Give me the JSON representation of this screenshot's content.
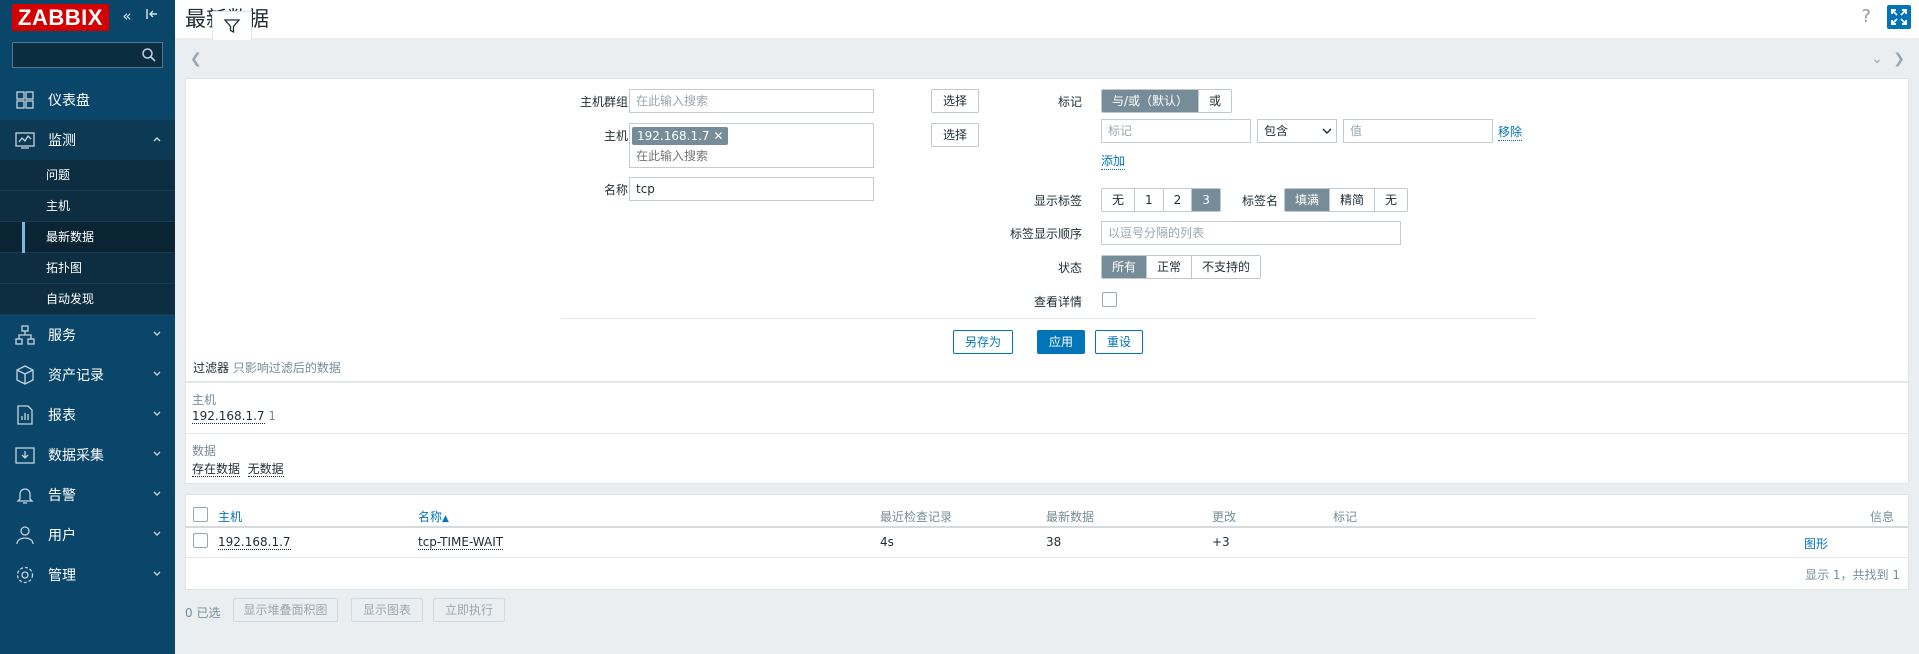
{
  "app": {
    "logo_text": "ZABBIX"
  },
  "header": {
    "title": "最新数据",
    "help": "?"
  },
  "sidebar": {
    "search": {
      "value": "",
      "placeholder": ""
    },
    "items": [
      {
        "label": "仪表盘",
        "icon": "dashboard-icon"
      },
      {
        "label": "监测",
        "icon": "monitoring-icon",
        "expanded": true,
        "children": [
          "问题",
          "主机",
          "最新数据",
          "拓扑图",
          "自动发现"
        ],
        "current": "最新数据"
      },
      {
        "label": "服务",
        "icon": "services-icon"
      },
      {
        "label": "资产记录",
        "icon": "inventory-icon"
      },
      {
        "label": "报表",
        "icon": "reports-icon"
      },
      {
        "label": "数据采集",
        "icon": "data-collection-icon"
      },
      {
        "label": "告警",
        "icon": "alerts-icon"
      },
      {
        "label": "用户",
        "icon": "users-icon"
      },
      {
        "label": "管理",
        "icon": "administration-icon"
      }
    ]
  },
  "filter": {
    "host_group": {
      "label": "主机群组",
      "placeholder": "在此输入搜索",
      "select": "选择"
    },
    "host": {
      "label": "主机",
      "chip": "192.168.1.7",
      "chip_remove": "✕",
      "placeholder": "在此输入搜索",
      "select": "选择"
    },
    "name": {
      "label": "名称",
      "value": "tcp"
    },
    "tags": {
      "label": "标记",
      "mode_options": [
        "与/或（默认）",
        "或"
      ],
      "mode_selected": "与/或（默认）",
      "tag_placeholder": "标记",
      "operator": "包含",
      "value_placeholder": "值",
      "remove": "移除",
      "add": "添加"
    },
    "show_tags": {
      "label": "显示标签",
      "options": [
        "无",
        "1",
        "2",
        "3"
      ],
      "selected": "3"
    },
    "tag_name": {
      "label": "标签名",
      "options": [
        "填满",
        "精简",
        "无"
      ],
      "selected": "填满"
    },
    "tag_priority": {
      "label": "标签显示顺序",
      "placeholder": "以逗号分隔的列表"
    },
    "state": {
      "label": "状态",
      "options": [
        "所有",
        "正常",
        "不支持的"
      ],
      "selected": "所有"
    },
    "show_details": {
      "label": "查看详情",
      "checked": false
    },
    "buttons": {
      "save_as": "另存为",
      "apply": "应用",
      "reset": "重设"
    },
    "note_title": "过滤器",
    "note_sub": "只影响过滤后的数据"
  },
  "subfilter": {
    "hosts_title": "主机",
    "host_value": "192.168.1.7",
    "host_count": "1",
    "data_title": "数据",
    "data_with": "存在数据",
    "data_without": "无数据"
  },
  "table": {
    "columns": [
      "主机",
      "名称",
      "最近检查记录",
      "最新数据",
      "更改",
      "标记",
      "信息"
    ],
    "sort_indicator": "▲",
    "rows": [
      {
        "host": "192.168.1.7",
        "name": "tcp-TIME-WAIT",
        "last_check": "4s",
        "last_value": "38",
        "change": "+3",
        "tags": "",
        "info": "图形"
      }
    ],
    "paging": "显示 1，共找到 1"
  },
  "footer": {
    "selected": "0 已选",
    "buttons": [
      "显示堆叠面积图",
      "显示图表",
      "立即执行"
    ]
  },
  "colors": {
    "sidebar": "#0a466a",
    "accent": "#0275b8",
    "logo": "#d40000",
    "segment_on": "#768d99"
  }
}
